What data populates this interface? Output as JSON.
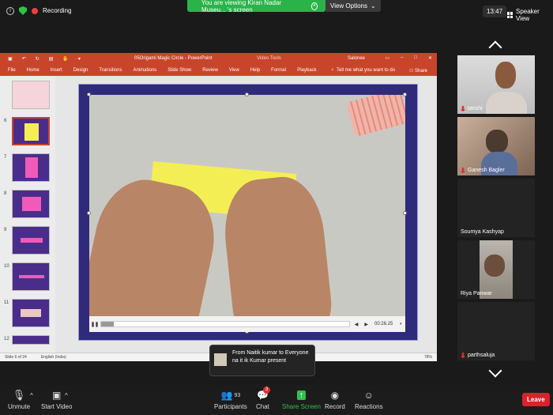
{
  "top": {
    "recording": "Recording",
    "viewing": "You are viewing Kiran Nadar Museu... 's screen",
    "view_options": "View Options",
    "time": "13:47",
    "speaker_view": "Speaker View"
  },
  "ppt": {
    "doc_title": "05Origami Magic Circle - PowerPoint",
    "video_tools": "Video Tools",
    "user": "Salonee",
    "tabs": [
      "File",
      "Home",
      "Insert",
      "Design",
      "Transitions",
      "Animations",
      "Slide Show",
      "Review",
      "View",
      "Help",
      "Format",
      "Playback"
    ],
    "tell_me": "Tell me what you want to do",
    "share": "Share",
    "thumb_numbers": [
      "6",
      "7",
      "8",
      "9",
      "10",
      "11",
      "12"
    ],
    "video_time": "00:26.25",
    "video_progress": 0.05,
    "status_slide": "Slide 6 of 24",
    "status_lang": "English (India)",
    "zoom": "78%"
  },
  "participants": [
    {
      "name": "tarishi",
      "muted": true
    },
    {
      "name": "Ganesh Bagler",
      "muted": true
    },
    {
      "name": "Soumya Kashyap",
      "muted": false
    },
    {
      "name": "Riya Panwar",
      "muted": false
    },
    {
      "name": "parthsaluja",
      "muted": true
    }
  ],
  "chat_toast": {
    "from": "From Naitik kumar to Everyone",
    "message": "na it ik Kumar present"
  },
  "toolbar": {
    "unmute": "Unmute",
    "start_video": "Start Video",
    "participants": "Participants",
    "participants_count": "93",
    "chat": "Chat",
    "chat_badge": "3",
    "share_screen": "Share Screen",
    "record": "Record",
    "reactions": "Reactions",
    "leave": "Leave"
  },
  "colors": {
    "ppt_red": "#c8452b",
    "zoom_green": "#2bb34a",
    "leave_red": "#d8232a",
    "slide_purple": "#2f2a7a"
  }
}
